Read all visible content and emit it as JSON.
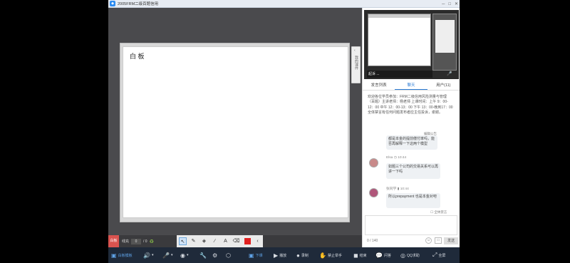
{
  "window": {
    "title": "2005FRM二级百题信用",
    "controls": [
      "─",
      "□",
      "✕"
    ]
  },
  "whiteboard": {
    "title": "白 板",
    "side_tab_label": "我的课件",
    "side_tab_chevron": "‹"
  },
  "drawbar": {
    "whiteboard_label": "白板",
    "page_label": "线充",
    "page_current": "0",
    "page_total": "/ 0",
    "tools": [
      {
        "name": "select-tool",
        "glyph": "↖"
      },
      {
        "name": "pen-tool",
        "glyph": "✎"
      },
      {
        "name": "shape-tool",
        "glyph": "◈"
      },
      {
        "name": "line-tool",
        "glyph": "∕"
      },
      {
        "name": "text-tool",
        "glyph": "A"
      },
      {
        "name": "eraser-tool",
        "glyph": "⌫"
      }
    ],
    "more": "‹",
    "color": "#e02020"
  },
  "video": {
    "caption": "起诉 ...",
    "mic_icon": "🎤"
  },
  "tabs": [
    {
      "label": "发言列表",
      "active": false
    },
    {
      "label": "聊天",
      "active": true
    },
    {
      "label": "用户(11)",
      "active": false
    }
  ],
  "chat": {
    "notice": "欢迎各位学员参加：FRM二级信用风险测量与管理（百题）主讲老师：杨老师 上课时间：上午 9：00-12：00 中午 12：00-13：00 下午 13：00-晚到17：00 全体禁言有任何问题发布者应主任投诉，谢谢。",
    "edit_notice": "编辑公告",
    "messages": [
      {
        "text": "都是本金的提前偿付率吗，能否再解释一下这两个模型"
      },
      {
        "user": "Elsa",
        "time": "10:44",
        "text": "如题三个公司的交易关系可以再讲一下吗"
      },
      {
        "user": "张同学",
        "time": "10:44",
        "text": "所以prepayment 也是本金对吧"
      }
    ],
    "expand": "全体禁言",
    "counter": "0 / 140",
    "send_label": "发送"
  },
  "bottombar": [
    {
      "name": "whiteboard-mode",
      "icon": "▣",
      "label": "白板模板"
    },
    {
      "name": "speaker",
      "icon": "🔊",
      "label": "▾"
    },
    {
      "name": "microphone",
      "icon": "🎤",
      "label": "▾"
    },
    {
      "name": "camera",
      "icon": "◉",
      "label": "▾"
    },
    {
      "name": "tools",
      "icon": "🔧",
      "label": ""
    },
    {
      "name": "settings",
      "icon": "⚙",
      "label": ""
    },
    {
      "name": "share",
      "icon": "⬡",
      "label": ""
    },
    {
      "name": "class-end",
      "icon": "▣",
      "label": "下课"
    },
    {
      "name": "play",
      "icon": "▶",
      "label": "播放"
    },
    {
      "name": "record",
      "icon": "●",
      "label": "录制"
    },
    {
      "name": "ban-hands",
      "icon": "✋",
      "label": "禁止举手"
    },
    {
      "name": "end-class",
      "icon": "◼",
      "label": "结束"
    },
    {
      "name": "reply",
      "icon": "💬",
      "label": "问答"
    },
    {
      "name": "qq-help",
      "icon": "◎",
      "label": "QQ求助"
    },
    {
      "name": "fullscreen",
      "icon": "⤢",
      "label": "全屏"
    }
  ]
}
